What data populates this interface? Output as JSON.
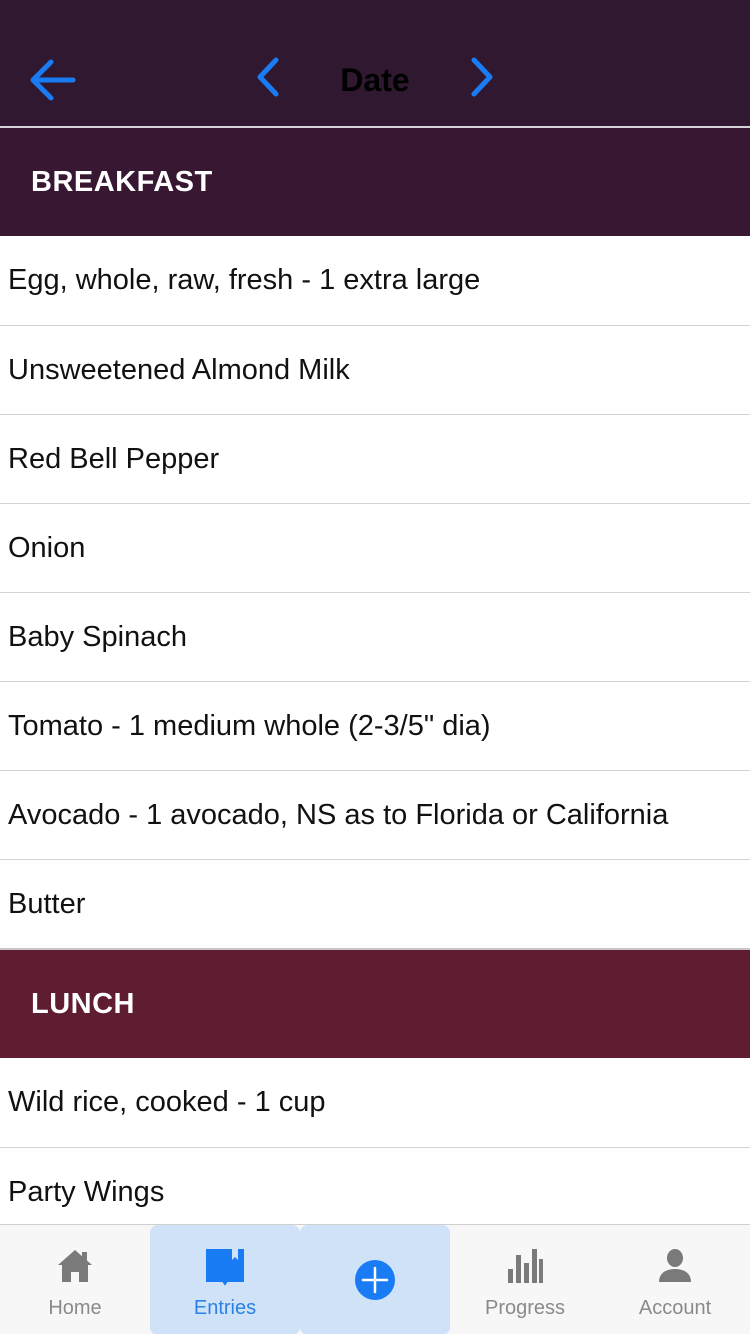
{
  "header": {
    "title": "Date"
  },
  "sections": [
    {
      "title": "BREAKFAST",
      "items": [
        "Egg, whole, raw, fresh - 1 extra large",
        "Unsweetened Almond Milk",
        "Red Bell Pepper",
        "Onion",
        "Baby Spinach",
        "Tomato - 1 medium whole (2-3/5\" dia)",
        "Avocado - 1 avocado, NS as to Florida or California",
        "Butter"
      ]
    },
    {
      "title": "LUNCH",
      "items": [
        "Wild rice, cooked - 1 cup",
        "Party Wings"
      ]
    }
  ],
  "tabbar": {
    "home_label": "Home",
    "entries_label": "Entries",
    "progress_label": "Progress",
    "account_label": "Account"
  },
  "icons": {
    "back": "arrow-left-icon",
    "prev": "chevron-left-icon",
    "next": "chevron-right-icon",
    "home": "home-icon",
    "entries": "book-icon",
    "add": "plus-circle-icon",
    "progress": "bar-chart-icon",
    "account": "person-icon"
  },
  "colors": {
    "header_bg": "#2f1830",
    "breakfast_bg": "#371731",
    "lunch_bg": "#5e1d31",
    "accent": "#1a7cf4",
    "selected_tab_bg": "#cfe2f8"
  }
}
